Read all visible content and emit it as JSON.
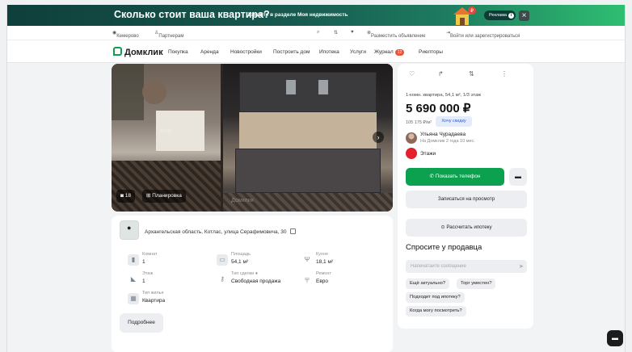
{
  "ad": {
    "title": "Сколько стоит ваша квартира?",
    "subtitle": "Узнайте в разделе Моя недвижимость",
    "badge": "Реклама",
    "close": "×"
  },
  "topbar": {
    "city": "Кемерово",
    "partners": "Партнерам",
    "post_ad": "Разместить объявление",
    "login": "Войти или зарегистрироваться"
  },
  "nav": {
    "logo": "Домклик",
    "links": [
      "Покупка",
      "Аренда",
      "Новостройки",
      "Построить дом",
      "Ипотека",
      "Услуги",
      "Журнал",
      "Риелторы"
    ],
    "journal_badge": "12"
  },
  "gallery": {
    "photo_count": "18",
    "plan_label": "Планировка",
    "watermarks": [
      "etagi",
      "Домклик"
    ]
  },
  "listing": {
    "address": "Архангельская область, Котлас, улица Серафимовича, 30",
    "features": [
      {
        "label": "Комнат",
        "value": "1",
        "icon": "door-icon"
      },
      {
        "label": "Площадь",
        "value": "54,1 м²",
        "icon": "area-icon"
      },
      {
        "label": "Кухня",
        "value": "18,1 м²",
        "icon": "cutlery-icon"
      },
      {
        "label": "Этаж",
        "value": "1",
        "icon": "stairs-icon"
      },
      {
        "label": "Тип сделки",
        "value": "Свободная продажа",
        "icon": "key-icon"
      },
      {
        "label": "Ремонт",
        "value": "Евро",
        "icon": "paint-roller-icon"
      },
      {
        "label": "Тип жилья",
        "value": "Квартира",
        "icon": "building-icon"
      }
    ],
    "more_label": "Подробнее"
  },
  "card": {
    "subtitle": "1-комн. квартира, 54,1 м², 1/3 этаж",
    "price": "5 690 000 ₽",
    "price_per_m2": "105 175 ₽/м²",
    "discount_label": "Хочу скидку",
    "seller_name": "Ульяна Чурадаева",
    "seller_since": "На Домклик 2 года 10 мес.",
    "agency": "Этажи",
    "phone_label": "Показать телефон",
    "viewing_label": "Записаться на просмотр",
    "mortgage_label": "Рассчитать ипотеку",
    "ask_title": "Спросите у продавца",
    "message_placeholder": "Напечатайте сообщение",
    "quick_questions": [
      "Ещё актуально?",
      "Торг уместен?",
      "Подходит под ипотеку?",
      "Когда могу посмотреть?"
    ]
  },
  "colors": {
    "accent": "#0ba14e",
    "banner": "#17584f",
    "discount_bg": "#e4ecfb",
    "discount_text": "#2e5bd6"
  }
}
